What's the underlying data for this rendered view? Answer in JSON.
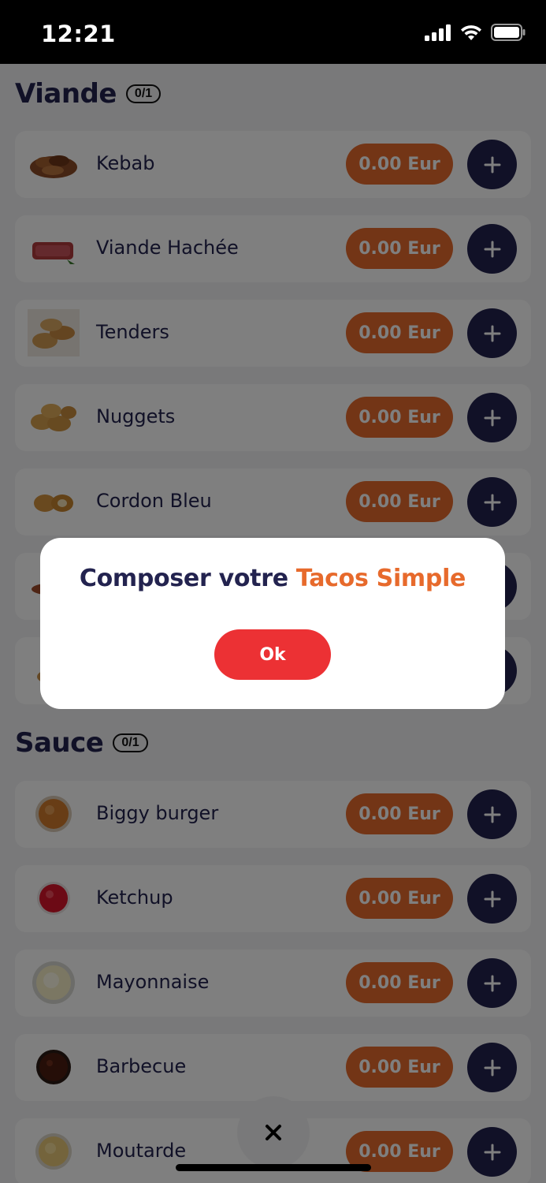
{
  "status_bar": {
    "time": "12:21"
  },
  "sections": [
    {
      "title": "Viande",
      "counter": "0/1",
      "items": [
        {
          "name": "Kebab",
          "price": "0.00 Eur",
          "image": "kebab"
        },
        {
          "name": "Viande Hachée",
          "price": "0.00 Eur",
          "image": "minced-meat"
        },
        {
          "name": "Tenders",
          "price": "0.00 Eur",
          "image": "tenders"
        },
        {
          "name": "Nuggets",
          "price": "0.00 Eur",
          "image": "nuggets"
        },
        {
          "name": "Cordon Bleu",
          "price": "0.00 Eur",
          "image": "cordon-bleu"
        },
        {
          "name": "",
          "price": "",
          "image": "sausage"
        },
        {
          "name": "",
          "price": "",
          "image": "wings"
        }
      ]
    },
    {
      "title": "Sauce",
      "counter": "0/1",
      "items": [
        {
          "name": "Biggy burger",
          "price": "0.00 Eur",
          "image": "sauce-orange"
        },
        {
          "name": "Ketchup",
          "price": "0.00 Eur",
          "image": "sauce-ketchup"
        },
        {
          "name": "Mayonnaise",
          "price": "0.00 Eur",
          "image": "sauce-mayo"
        },
        {
          "name": "Barbecue",
          "price": "0.00 Eur",
          "image": "sauce-bbq"
        },
        {
          "name": "Moutarde",
          "price": "0.00 Eur",
          "image": "sauce-mustard"
        }
      ]
    }
  ],
  "dialog": {
    "title_prefix": "Composer votre",
    "title_highlight": "Tacos Simple",
    "ok_label": "Ok"
  },
  "close_button": {
    "icon": "close-icon"
  },
  "colors": {
    "primary": "#23234f",
    "accent": "#e76a2c",
    "ok_button": "#ec3134",
    "overlay": "rgba(0,0,0,0.5)"
  }
}
